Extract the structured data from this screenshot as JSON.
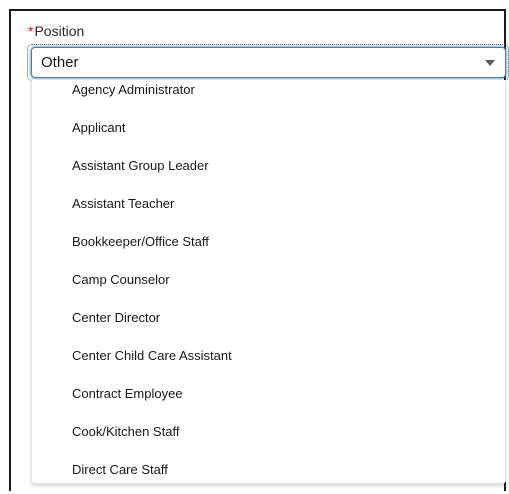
{
  "field": {
    "required_marker": "*",
    "label": "Position"
  },
  "combobox": {
    "value": "Other",
    "caret_icon": "caret-down-icon"
  },
  "options": [
    "Agency Administrator",
    "Applicant",
    "Assistant Group Leader",
    "Assistant Teacher",
    "Bookkeeper/Office Staff",
    "Camp Counselor",
    "Center Director",
    "Center Child Care Assistant",
    "Contract Employee",
    "Cook/Kitchen Staff",
    "Direct Care Staff"
  ],
  "colors": {
    "required": "#ea001e",
    "focus": "#0176d3",
    "text": "#181818",
    "border": "#747474"
  }
}
